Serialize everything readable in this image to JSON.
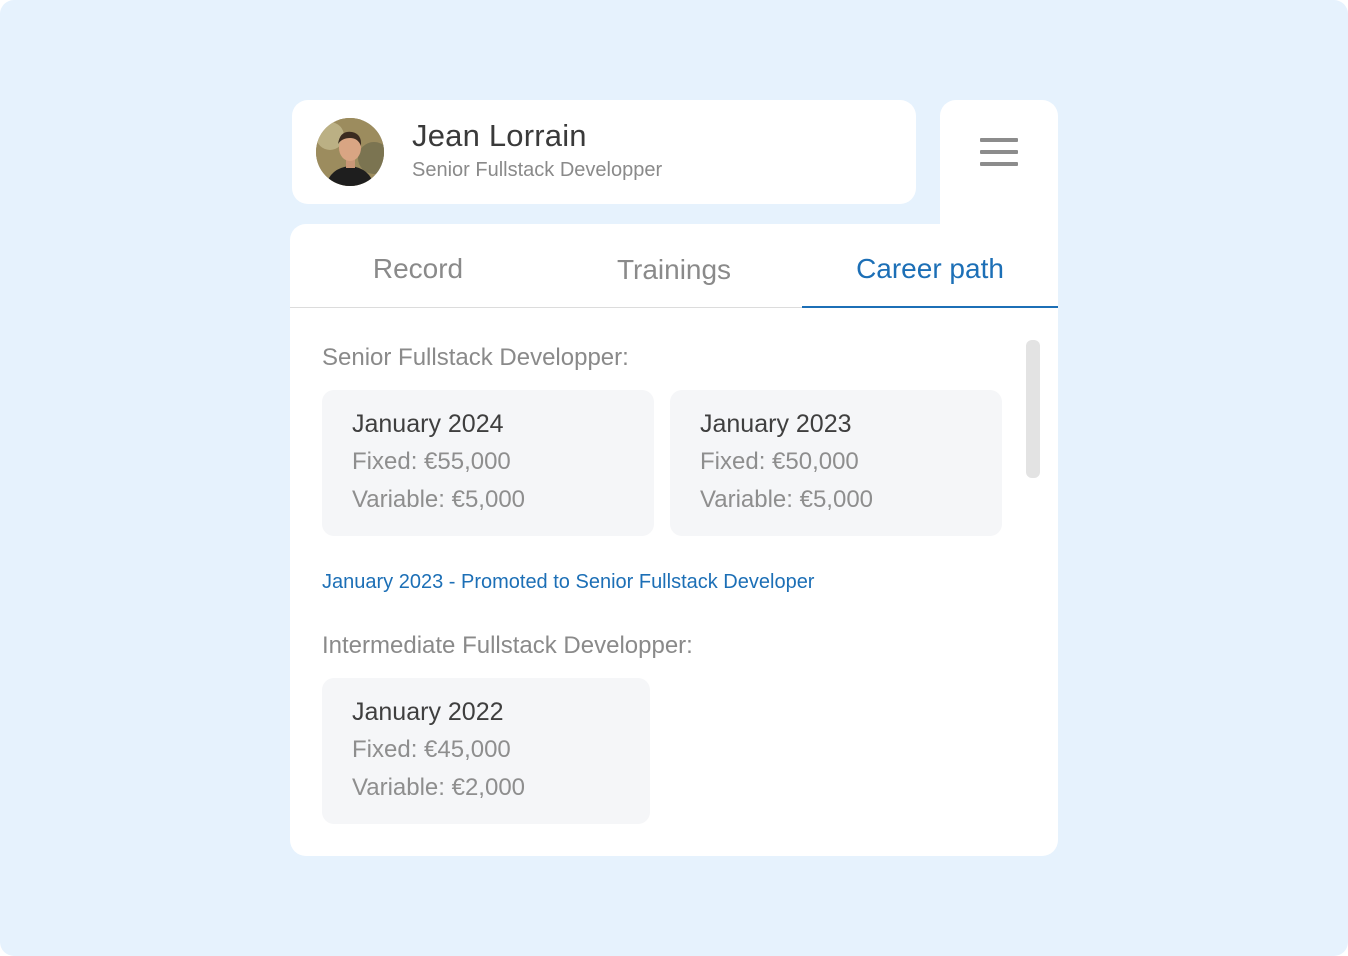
{
  "profile": {
    "name": "Jean Lorrain",
    "role": "Senior Fullstack Developper"
  },
  "menu": {
    "icon": "hamburger-menu-icon"
  },
  "tabs": [
    {
      "label": "Record",
      "active": false
    },
    {
      "label": "Trainings",
      "active": false
    },
    {
      "label": "Career path",
      "active": true
    }
  ],
  "career": {
    "sections": [
      {
        "title": "Senior Fullstack Developper:",
        "entries": [
          {
            "date": "January 2024",
            "fixed": "Fixed: €55,000",
            "variable": "Variable: €5,000"
          },
          {
            "date": "January 2023",
            "fixed": "Fixed: €50,000",
            "variable": "Variable: €5,000"
          }
        ]
      },
      {
        "title": "Intermediate Fullstack Developper:",
        "entries": [
          {
            "date": "January 2022",
            "fixed": "Fixed: €45,000",
            "variable": "Variable: €2,000"
          }
        ]
      }
    ],
    "promotion": "January 2023 - Promoted to Senior Fullstack Developer"
  },
  "colors": {
    "accent": "#1c6fb6",
    "background": "#e6f2fd",
    "card": "#ffffff",
    "entry_card": "#f5f6f8"
  }
}
